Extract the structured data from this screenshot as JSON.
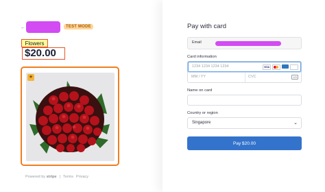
{
  "merchant": {
    "back_icon": "arrow-left-icon",
    "test_mode_badge": "TEST MODE"
  },
  "product": {
    "name": "Flowers",
    "price": "$20.00",
    "image_subject": "bouquet of red roses"
  },
  "footer": {
    "powered_by": "Powered by",
    "brand": "stripe",
    "terms": "Terms",
    "privacy": "Privacy"
  },
  "form": {
    "title": "Pay with card",
    "email_label": "Email",
    "card_info_label": "Card information",
    "card_number_placeholder": "1234 1234 1234 1234",
    "expiry_placeholder": "MM / YY",
    "cvc_placeholder": "CVC",
    "card_brands": [
      "VISA",
      "MC",
      "AMEX",
      "JCB"
    ],
    "name_label": "Name on card",
    "country_label": "Country or region",
    "country_value": "Singapore",
    "pay_button": "Pay $20.00"
  },
  "colors": {
    "accent": "#3473cc",
    "redaction": "#d24bf3",
    "highlight_border": "#e8542a",
    "test_mode_bg": "#ffd699"
  }
}
